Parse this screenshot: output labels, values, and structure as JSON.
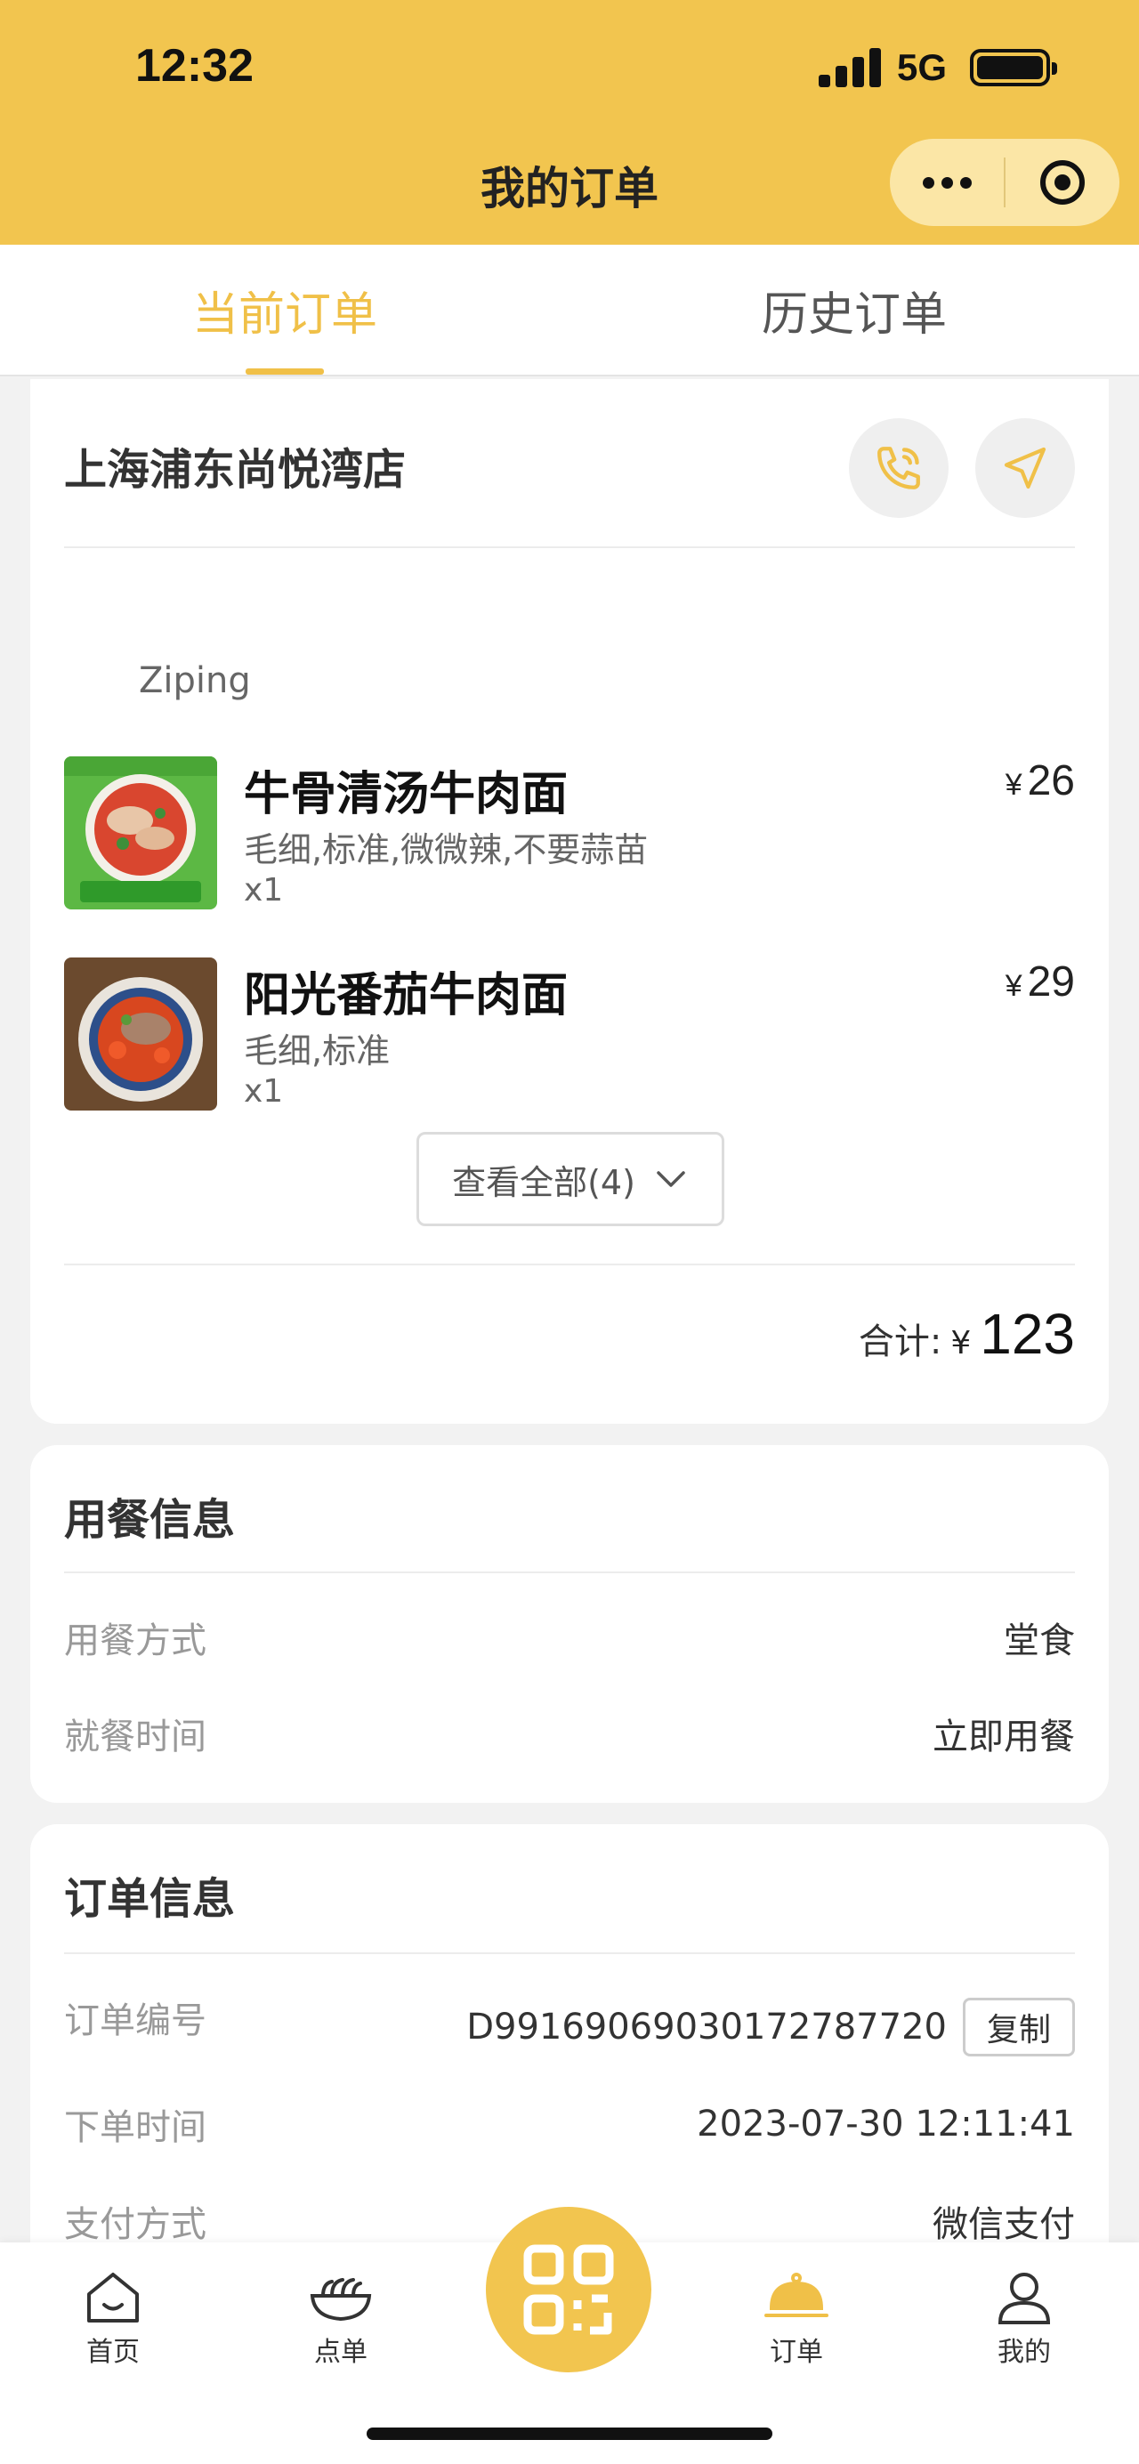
{
  "status_bar": {
    "time": "12:32",
    "network": "5G"
  },
  "nav": {
    "title": "我的订单",
    "more_icon": "more-dots-icon",
    "close_icon": "target-icon"
  },
  "tabs": [
    {
      "label": "当前订单",
      "active": true
    },
    {
      "label": "历史订单",
      "active": false
    }
  ],
  "order_card": {
    "store_name": "上海浦东尚悦湾店",
    "phone_icon": "phone-icon",
    "navigate_icon": "navigation-arrow-icon",
    "customer": "Ziping",
    "items": [
      {
        "name": "牛骨清汤牛肉面",
        "spec": "毛细,标准,微微辣,不要蒜苗",
        "qty": "x1",
        "currency": "¥",
        "price": "26"
      },
      {
        "name": "阳光番茄牛肉面",
        "spec": "毛细,标准",
        "qty": "x1",
        "currency": "¥",
        "price": "29"
      }
    ],
    "view_all": "查看全部(4)",
    "total_label": "合计:",
    "total_currency": "¥",
    "total_amount": "123"
  },
  "dining_info": {
    "title": "用餐信息",
    "rows": [
      {
        "key": "用餐方式",
        "value": "堂食"
      },
      {
        "key": "就餐时间",
        "value": "立即用餐"
      }
    ]
  },
  "order_info": {
    "title": "订单信息",
    "rows": [
      {
        "key": "订单编号",
        "value": "D99169069030172787720"
      },
      {
        "key": "下单时间",
        "value": "2023-07-30 12:11:41"
      },
      {
        "key": "支付方式",
        "value": "微信支付"
      }
    ],
    "copy_label": "复制"
  },
  "bottom_nav": [
    {
      "label": "首页",
      "icon": "home-icon"
    },
    {
      "label": "点单",
      "icon": "noodle-bowl-icon"
    },
    {
      "label": "",
      "icon": "qr-code-icon"
    },
    {
      "label": "订单",
      "icon": "cloche-icon"
    },
    {
      "label": "我的",
      "icon": "person-icon"
    }
  ],
  "colors": {
    "brand": "#f2c54f",
    "accent": "#f0c048"
  }
}
